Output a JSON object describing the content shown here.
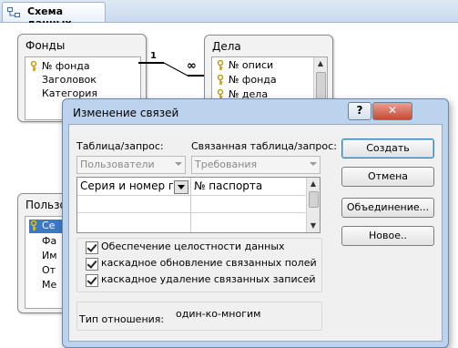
{
  "tab": {
    "title": "Схема данных",
    "icon": "relationships-icon"
  },
  "tables": {
    "fondy": {
      "title": "Фонды",
      "fields": [
        {
          "name": "№ фонда",
          "key": true
        },
        {
          "name": "Заголовок",
          "key": false
        },
        {
          "name": "Категория",
          "key": false
        }
      ]
    },
    "dela": {
      "title": "Дела",
      "fields": [
        {
          "name": "№ описи",
          "key": true
        },
        {
          "name": "№ фонда",
          "key": true
        },
        {
          "name": "№ дела",
          "key": true
        }
      ]
    },
    "polzovateli": {
      "title": "Пользо",
      "fields": [
        {
          "name": "Се",
          "key": true,
          "selected": true
        },
        {
          "name": "Фа",
          "key": false
        },
        {
          "name": "Им",
          "key": false
        },
        {
          "name": "От",
          "key": false
        },
        {
          "name": "Ме",
          "key": false
        }
      ]
    }
  },
  "relation": {
    "one_label": "1",
    "many_label": "∞"
  },
  "dialog": {
    "title": "Изменение связей",
    "help": "?",
    "close": "✕",
    "table_label": "Таблица/запрос:",
    "related_label": "Связанная таблица/запрос:",
    "table_value": "Пользователи",
    "related_value": "Требования",
    "grid": {
      "left": "Серия и номер п",
      "right": "№ паспорта"
    },
    "checkboxes": [
      {
        "label": "Обеспечение целостности данных",
        "checked": true
      },
      {
        "label": "каскадное обновление связанных полей",
        "checked": true
      },
      {
        "label": "каскадное удаление связанных записей",
        "checked": true
      }
    ],
    "relation_type_label": "Тип отношения:",
    "relation_type_value": "один-ко-многим",
    "buttons": {
      "create": "Создать",
      "cancel": "Отмена",
      "join": "Объединение...",
      "new": "Новое.."
    }
  },
  "colors": {
    "accent": "#3d78c4",
    "dialog_frame": "#bcd3ee"
  }
}
